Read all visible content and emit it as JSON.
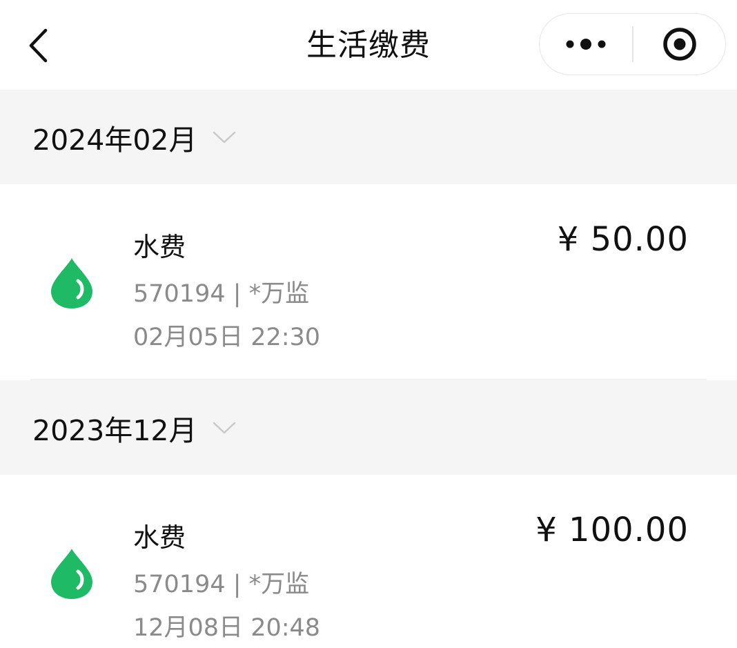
{
  "header": {
    "title": "生活缴费",
    "back_icon": "chevron-left-icon",
    "more_icon": "more-dots-icon",
    "close_icon": "target-close-icon"
  },
  "groups": [
    {
      "month": "2024年02月",
      "records": [
        {
          "name": "水费",
          "amount": "¥ 50.00",
          "account": "570194 | *万监",
          "time": "02月05日 22:30",
          "icon": "water-drop-icon"
        }
      ]
    },
    {
      "month": "2023年12月",
      "records": [
        {
          "name": "水费",
          "amount": "¥ 100.00",
          "account": "570194 | *万监",
          "time": "12月08日 20:48",
          "icon": "water-drop-icon"
        }
      ]
    }
  ],
  "colors": {
    "accent_green": "#1fba66",
    "section_bg": "#f5f5f5",
    "secondary_text": "#8a8a8a"
  }
}
